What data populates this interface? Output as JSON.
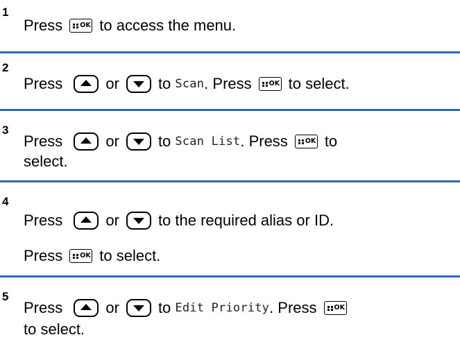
{
  "steps": [
    {
      "number": "1",
      "line1": {
        "press": "Press",
        "rest": "to access the menu."
      }
    },
    {
      "number": "2",
      "line1": {
        "press": "Press",
        "or": "or",
        "to": "to",
        "target": "Scan",
        "press2": ". Press",
        "rest": "to select."
      }
    },
    {
      "number": "3",
      "line1": {
        "press": "Press",
        "or": "or",
        "to": "to",
        "target": "Scan List",
        "press2": ". Press",
        "rest": "to"
      },
      "line2": "select."
    },
    {
      "number": "4",
      "line1": {
        "press": "Press",
        "or": "or",
        "rest": "to the required alias or ID."
      },
      "line2": {
        "press": "Press",
        "rest": "to select."
      }
    },
    {
      "number": "5",
      "line1": {
        "press": "Press",
        "or": "or",
        "to": "to",
        "target": "Edit Priority",
        "press2": ". Press"
      },
      "line2": "to select."
    }
  ],
  "icons": {
    "ok_key": {
      "name": "menu-ok-key-icon",
      "label": "OK"
    },
    "up_key": "up-arrow-key-icon",
    "down_key": "down-arrow-key-icon"
  },
  "colors": {
    "separator": "#2e68b1",
    "text": "#000000",
    "menu_text": "#222222"
  }
}
